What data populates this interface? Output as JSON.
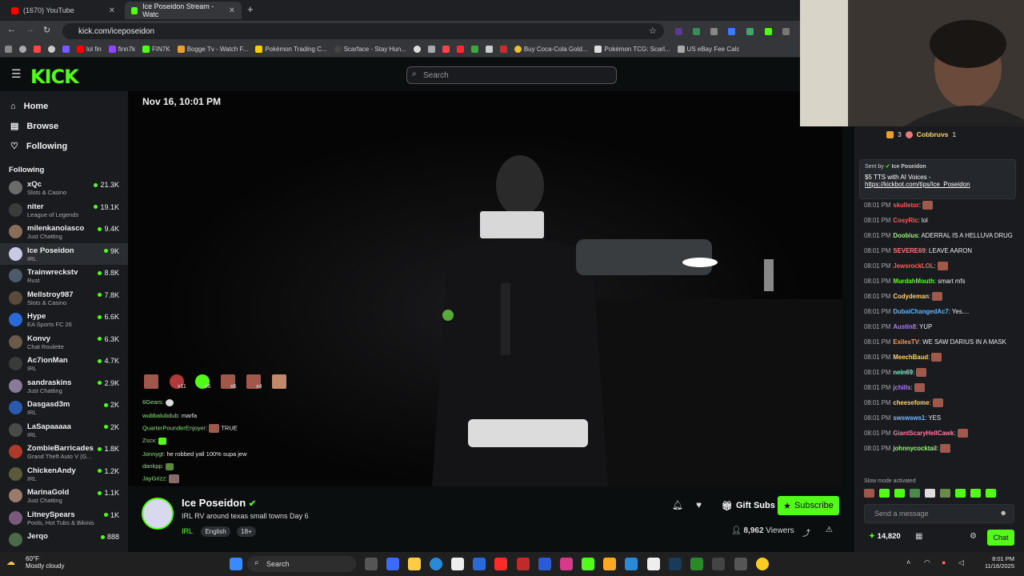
{
  "browser": {
    "tabs": [
      {
        "label": "(1670) YouTube",
        "active": false
      },
      {
        "label": "Ice Poseidon Stream - Watc",
        "active": true
      }
    ],
    "url": "kick.com/iceposeidon",
    "bookmarks": [
      "lol fin",
      "finn7k",
      "FIN7K",
      "Bogge Tv - Watch F...",
      "Pokémon Trading C...",
      "Scarface - Stay Hun...",
      "Buy Coca-Cola Gold...",
      "Pokémon TCG: Scarl...",
      "US eBay Fee Calc"
    ]
  },
  "header": {
    "logo": "KICK",
    "search_placeholder": "Search"
  },
  "sidebar": {
    "nav": [
      {
        "label": "Home",
        "icon": "home-icon"
      },
      {
        "label": "Browse",
        "icon": "browse-icon"
      },
      {
        "label": "Following",
        "icon": "heart-icon"
      }
    ],
    "following_heading": "Following",
    "channels": [
      {
        "name": "xQc",
        "category": "Slots & Casino",
        "viewers": "21.3K",
        "color": "#6b6b6b"
      },
      {
        "name": "niter",
        "category": "League of Legends",
        "viewers": "19.1K",
        "color": "#3b3b3b"
      },
      {
        "name": "milenkanolasco",
        "category": "Just Chatting",
        "viewers": "9.4K",
        "color": "#8a6c5a"
      },
      {
        "name": "Ice Poseidon",
        "category": "IRL",
        "viewers": "9K",
        "color": "#c9c9e6",
        "selected": true
      },
      {
        "name": "Trainwreckstv",
        "category": "Rust",
        "viewers": "8.8K",
        "color": "#4d5a6a"
      },
      {
        "name": "Mellstroy987",
        "category": "Slots & Casino",
        "viewers": "7.8K",
        "color": "#5a4a3a"
      },
      {
        "name": "Hype",
        "category": "EA Sports FC 26",
        "viewers": "6.6K",
        "color": "#2a6ad8"
      },
      {
        "name": "Konvy",
        "category": "Chat Roulette",
        "viewers": "6.3K",
        "color": "#6a5a4a"
      },
      {
        "name": "Ac7ionMan",
        "category": "IRL",
        "viewers": "4.7K",
        "color": "#3a3a3a"
      },
      {
        "name": "sandraskins",
        "category": "Just Chatting",
        "viewers": "2.9K",
        "color": "#8a7a9a"
      },
      {
        "name": "Dasgasd3m",
        "category": "IRL",
        "viewers": "2K",
        "color": "#2a5ab0"
      },
      {
        "name": "LaSapaaaaa",
        "category": "IRL",
        "viewers": "2K",
        "color": "#4a4a4a"
      },
      {
        "name": "ZombieBarricades",
        "category": "Grand Theft Auto V (G...",
        "viewers": "1.8K",
        "color": "#b03a2a"
      },
      {
        "name": "ChickenAndy",
        "category": "IRL",
        "viewers": "1.2K",
        "color": "#5a5a3a"
      },
      {
        "name": "MarinaGold",
        "category": "Just Chatting",
        "viewers": "1.1K",
        "color": "#9a7a6a"
      },
      {
        "name": "LitneySpears",
        "category": "Pools, Hot Tubs & Bikinis",
        "viewers": "1K",
        "color": "#7a5a7a"
      },
      {
        "name": "Jerqo",
        "category": "",
        "viewers": "888",
        "color": "#4a6a4a"
      }
    ]
  },
  "video": {
    "timestamp": "Nov 16, 10:01 PM",
    "overlay_counts": [
      "x11",
      "x6",
      "x6",
      "x4"
    ],
    "overlay_chat": [
      {
        "user": "6Gears:",
        "text": ""
      },
      {
        "user": "wubbalubdub:",
        "text": "marfa"
      },
      {
        "user": "QuarterPounderEnjoyer:",
        "text": "TRUE"
      },
      {
        "user": "Zscx:",
        "text": ""
      },
      {
        "user": "Jonnygt:",
        "text": "he robbed yall 100% supa jew"
      },
      {
        "user": "dankpp:",
        "text": ""
      },
      {
        "user": "JayGrizz:",
        "text": ""
      }
    ]
  },
  "stream": {
    "channel_name": "Ice Poseidon",
    "title": "IRL RV around texas small towns Day 6",
    "tags": [
      "IRL",
      "English",
      "18+"
    ],
    "gift_subs_label": "Gift Subs",
    "subscribe_label": "Subscribe",
    "viewers": "8,962",
    "viewers_label": "Viewers"
  },
  "chat": {
    "top_users": [
      {
        "rank": "3",
        "name": "Cobbruvs",
        "count": "1"
      }
    ],
    "pinned": {
      "sent_by_label": "Sent by",
      "sent_by": "Ice Poseidon",
      "text": "$5 TTS with AI Voices -",
      "link": "https://kickbot.com/tips/Ice_Poseidon"
    },
    "messages": [
      {
        "time": "08:01 PM",
        "user": "skulletor",
        "color": "#ff5a5a",
        "text": "",
        "emote": true
      },
      {
        "time": "08:01 PM",
        "user": "CosyRic",
        "color": "#ff5a5a",
        "text": "lol",
        "emote": false
      },
      {
        "time": "08:01 PM",
        "user": "Doobius",
        "color": "#9bf27a",
        "text": "ADERRAL IS A HELLUVA DRUG",
        "emote": false
      },
      {
        "time": "08:01 PM",
        "user": "SEVERE69",
        "color": "#ff7a7a",
        "text": "LEAVE AARON",
        "emote": false
      },
      {
        "time": "08:01 PM",
        "user": "JewsrockLOL",
        "color": "#ff5a5a",
        "text": "",
        "emote": true
      },
      {
        "time": "08:01 PM",
        "user": "MurdahMouth",
        "color": "#53fc18",
        "text": "smart mfs",
        "emote": false
      },
      {
        "time": "08:01 PM",
        "user": "Codydeman",
        "color": "#ffd36a",
        "text": "",
        "emote": true
      },
      {
        "time": "08:01 PM",
        "user": "DubaiChangedAc7",
        "color": "#5ab8ff",
        "text": "Yes....",
        "emote": false
      },
      {
        "time": "08:01 PM",
        "user": "Austin8",
        "color": "#b07aff",
        "text": "YUP",
        "emote": false
      },
      {
        "time": "08:01 PM",
        "user": "ExilesTV",
        "color": "#ff9a4a",
        "text": "WE SAW DARIUS IN A MASK",
        "emote": false
      },
      {
        "time": "08:01 PM",
        "user": "MeechBaud",
        "color": "#ffd36a",
        "text": "",
        "emote": true
      },
      {
        "time": "08:01 PM",
        "user": "nein69",
        "color": "#7af2d0",
        "text": "",
        "emote": true
      },
      {
        "time": "08:01 PM",
        "user": "jchills",
        "color": "#b07aff",
        "text": "",
        "emote": true
      },
      {
        "time": "08:01 PM",
        "user": "cheesefome",
        "color": "#ffd36a",
        "text": "",
        "emote": true
      },
      {
        "time": "08:01 PM",
        "user": "swswsws1",
        "color": "#7ab8ff",
        "text": "YES",
        "emote": false
      },
      {
        "time": "08:01 PM",
        "user": "GiantScaryHellCawk",
        "color": "#ff7aa0",
        "text": "",
        "emote": true
      },
      {
        "time": "08:01 PM",
        "user": "johnnycocktail",
        "color": "#9bf27a",
        "text": "",
        "emote": true
      }
    ],
    "slow_mode": "Slow mode activated",
    "input_placeholder": "Send a message",
    "points": "14,820",
    "chat_button": "Chat"
  },
  "taskbar": {
    "weather_temp": "60°F",
    "weather_desc": "Mostly cloudy",
    "search_label": "Search",
    "time": "8:01 PM",
    "date": "11/16/2025"
  }
}
